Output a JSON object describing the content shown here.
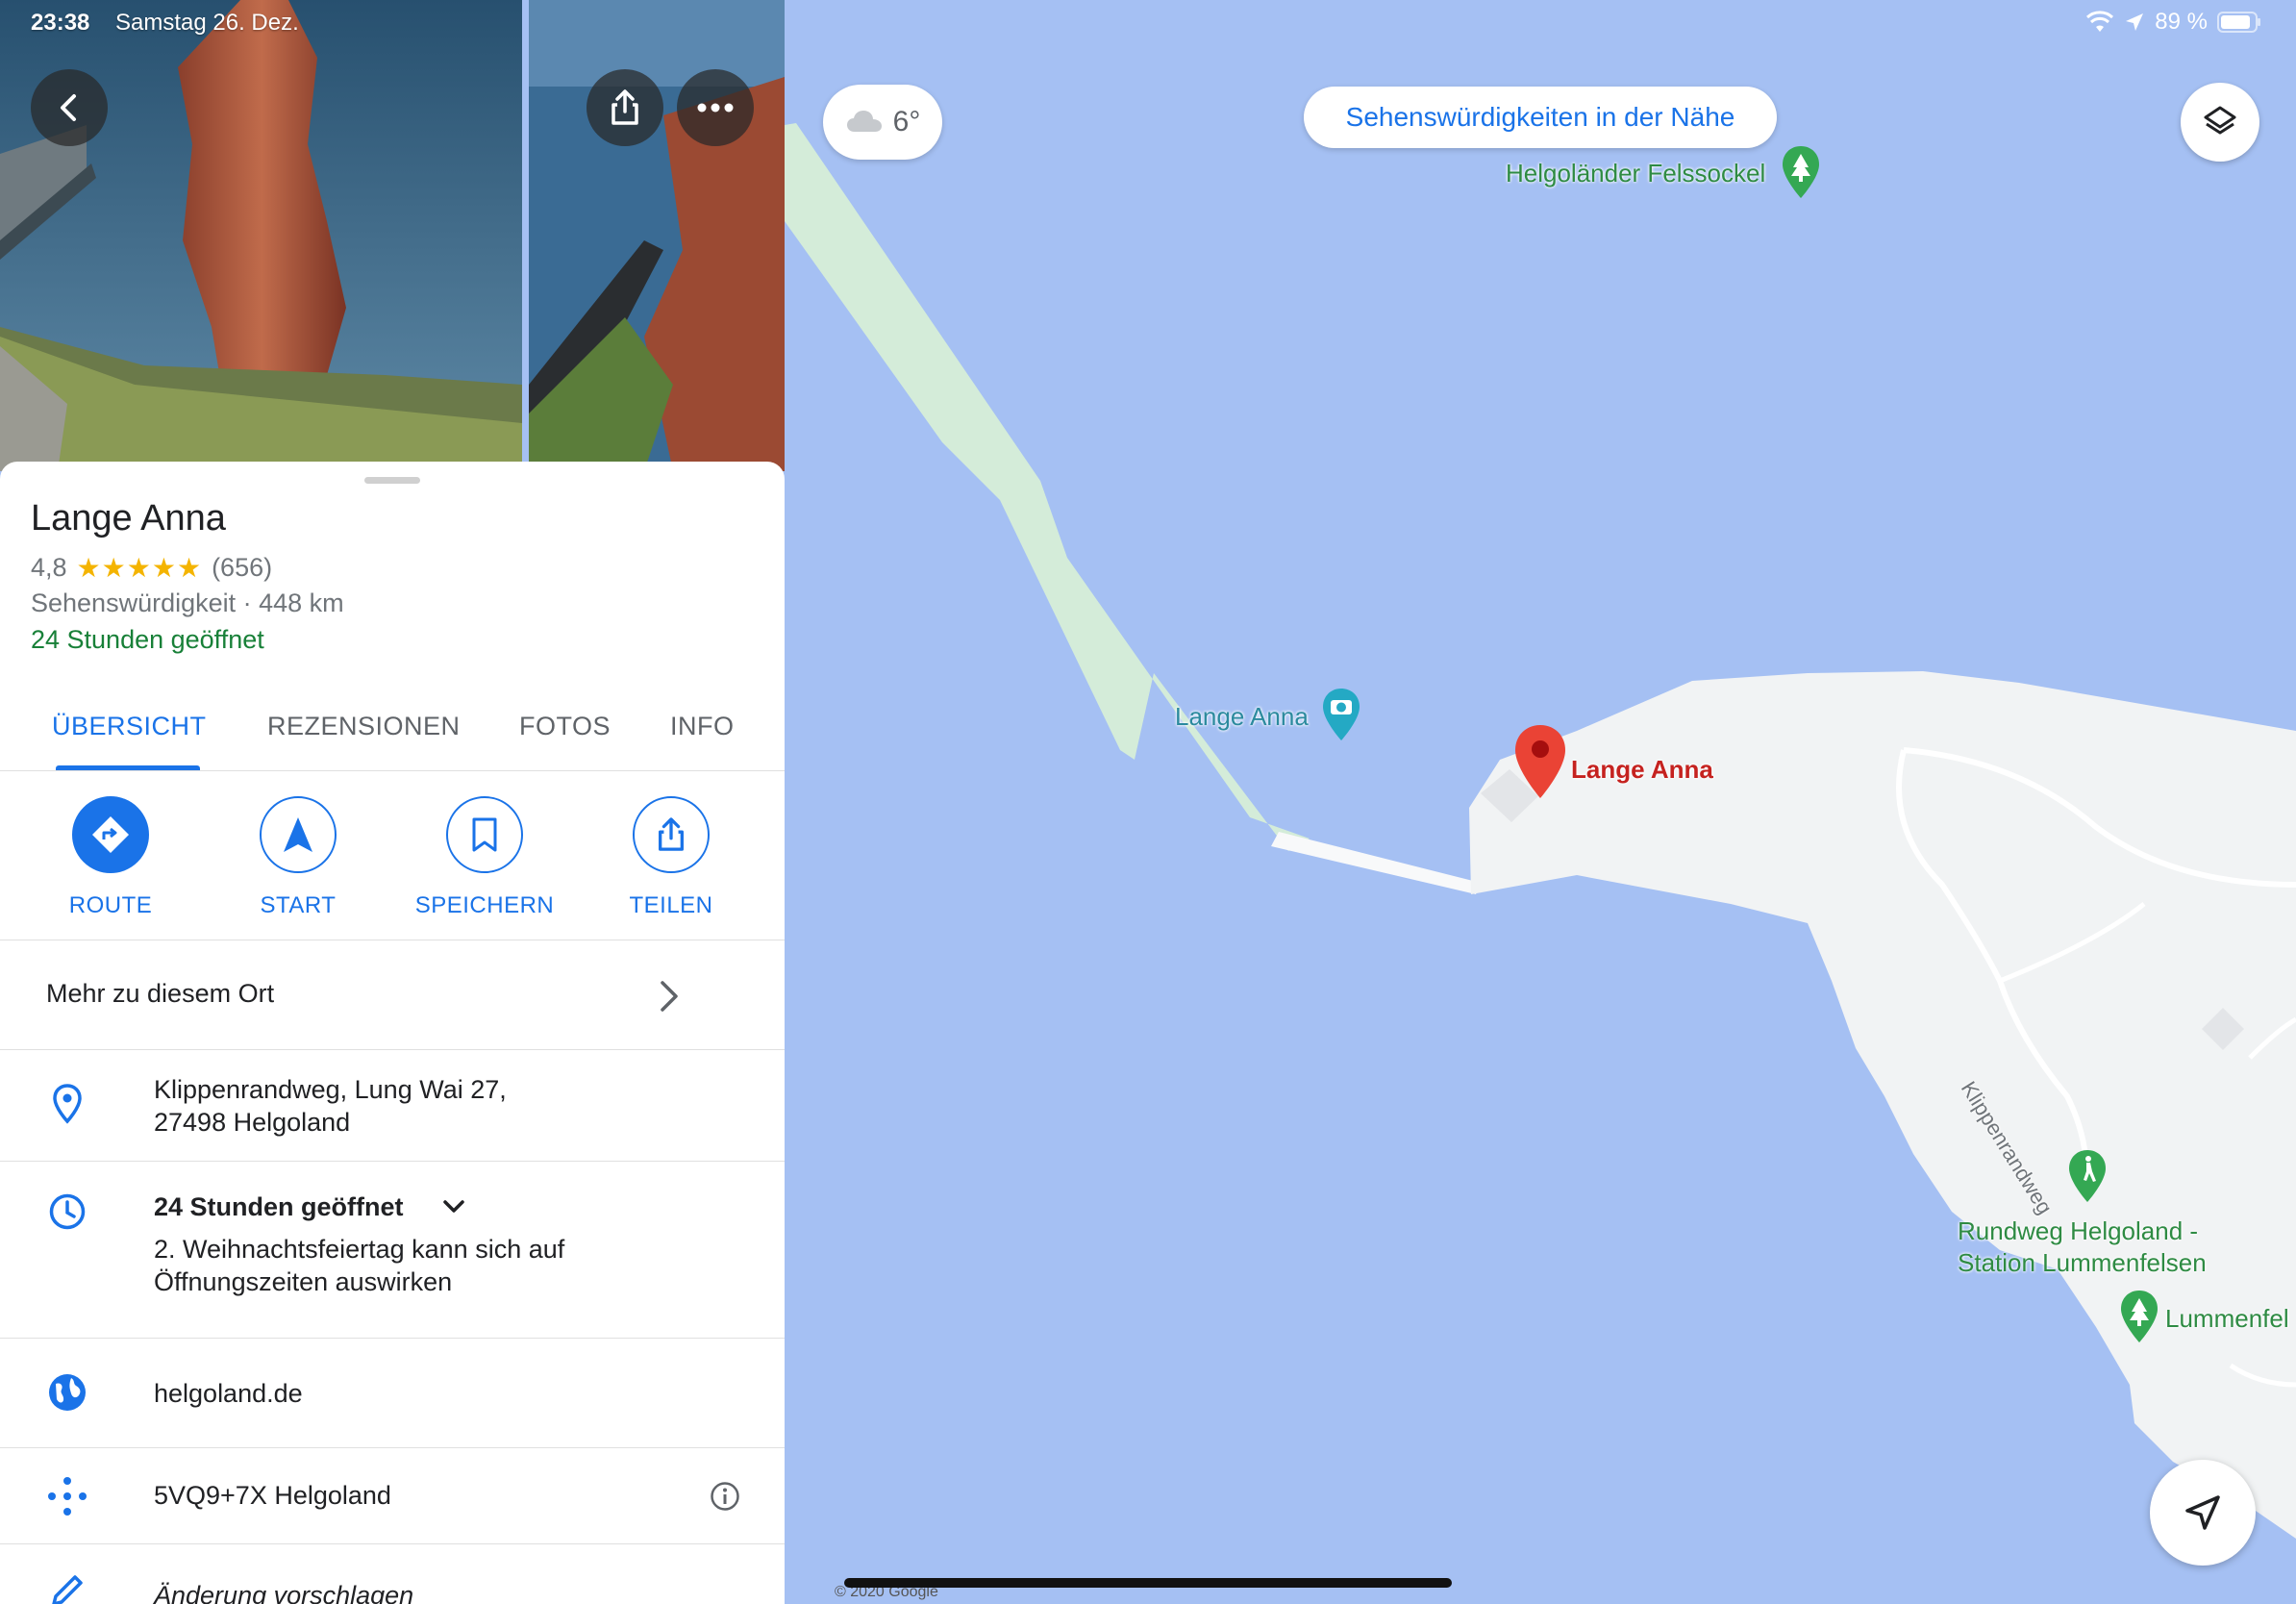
{
  "status_bar": {
    "time": "23:38",
    "date": "Samstag 26. Dez.",
    "battery_percent": "89 %",
    "battery_level": 0.89
  },
  "place": {
    "name": "Lange Anna",
    "rating": "4,8",
    "stars": "★★★★★",
    "review_count": "(656)",
    "category_distance": "Sehenswürdigkeit · 448 km",
    "open_status": "24 Stunden geöffnet"
  },
  "tabs": [
    {
      "label": "ÜBERSICHT",
      "active": true
    },
    {
      "label": "REZENSIONEN",
      "active": false
    },
    {
      "label": "FOTOS",
      "active": false
    },
    {
      "label": "INFO",
      "active": false
    }
  ],
  "actions": [
    {
      "label": "ROUTE",
      "icon": "directions-icon"
    },
    {
      "label": "START",
      "icon": "navigation-arrow-icon"
    },
    {
      "label": "SPEICHERN",
      "icon": "bookmark-icon"
    },
    {
      "label": "TEILEN",
      "icon": "share-icon"
    }
  ],
  "more_row": {
    "label": "Mehr zu diesem Ort"
  },
  "address": {
    "line1": "Klippenrandweg, Lung Wai 27,",
    "line2": "27498 Helgoland"
  },
  "hours": {
    "label": "24 Stunden geöffnet",
    "notice_line1": "2. Weihnachtsfeiertag kann sich auf",
    "notice_line2": "Öffnungszeiten auswirken"
  },
  "website": "helgoland.de",
  "plus_code": "5VQ9+7X Helgoland",
  "suggest_edit": "Änderung vorschlagen",
  "map": {
    "weather_temp": "6°",
    "nearby_button": "Sehenswürdigkeiten in der Nähe",
    "labels": {
      "felssockel": "Helgoländer Felssockel",
      "lange_anna_poi": "Lange Anna",
      "lange_anna_pin": "Lange Anna",
      "klippenrandweg": "Klippenrandweg",
      "rundweg_line1": "Rundweg Helgoland -",
      "rundweg_line2": "Station Lummenfelsen",
      "lummenfelsen": "Lummenfel"
    },
    "copyright": "© 2020 Google",
    "colors": {
      "water": "#a5c0f3",
      "land": "#f1f3f4",
      "park": "#d4ecd9",
      "pin": "#ea4335",
      "accent": "#1a73e8"
    }
  }
}
